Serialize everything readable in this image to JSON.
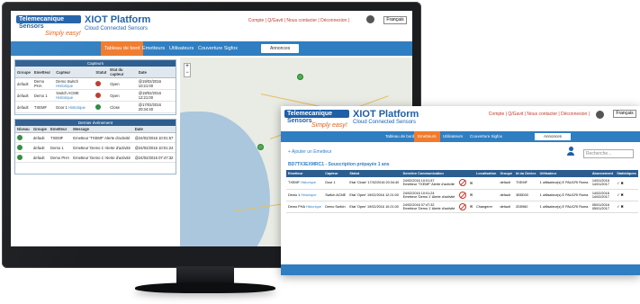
{
  "brand": {
    "logo_top": "Telemecanique",
    "logo_bottom": "Sensors",
    "tagline": "Simply easy!"
  },
  "app": {
    "title": "XIOT Platform",
    "subtitle": "Cloud Connected Sensors"
  },
  "top_links": "Compte | Q/Gavit | Nous contacter | Déconnexion |",
  "language": "Français",
  "nav": {
    "tabs": [
      "Tableau de bord",
      "Emetteurs",
      "Utilisateurs",
      "Couverture Sigfox"
    ],
    "active": 0,
    "button": "Annonces"
  },
  "capteurs_panel": {
    "title": "Capteurs",
    "headers": [
      "Groupe",
      "Emetteur",
      "Capteur",
      "Statut",
      "Etat du capteur",
      "Date"
    ],
    "rows": [
      {
        "groupe": "default",
        "emetteur": "Demo PHA",
        "capteur": "Demo Switch",
        "capteur_link": "Historique",
        "statut_color": "red",
        "etat": "Open",
        "date": "@19/02/2016 10:21:00"
      },
      {
        "groupe": "default",
        "emetteur": "Demo 1",
        "capteur": "Switch ACME",
        "capteur_link": "Historique",
        "statut_color": "red",
        "etat": "Open",
        "date": "@19/02/2016 12:21:00"
      },
      {
        "groupe": "default",
        "emetteur": "TXEMF",
        "capteur": "Door 1",
        "capteur_link": "Historique",
        "statut_color": "green",
        "etat": "Close",
        "date": "@17/02/2016 20:34:40"
      }
    ]
  },
  "events_panel": {
    "title": "Dernier événement",
    "headers": [
      "Niveau",
      "Groupe",
      "Emetteur",
      "Message",
      "Date"
    ],
    "rows": [
      {
        "groupe": "default",
        "emetteur": "TXEMF",
        "message": "Emetteur 'TXEMF' Alerte d'activité",
        "date": "@24/02/2016 10:01:57"
      },
      {
        "groupe": "default",
        "emetteur": "Demo 1",
        "message": "Emetteur 'Demo 1' Alerte d'activité",
        "date": "@24/02/2016 10:01:24"
      },
      {
        "groupe": "default",
        "emetteur": "Demo PHA",
        "message": "Emetteur 'Demo 1' Alerte d'activité",
        "date": "@24/02/2016 07:47:32"
      }
    ]
  },
  "window2": {
    "add_link": "+ Ajouter un Emetteur",
    "section_title": "BD7TX3EXMRC1 - Souscription prépayée 1 ans",
    "search_placeholder": "Recherche...",
    "nav_tabs": [
      "Tableau de bord",
      "Emetteurs",
      "Utilisateurs",
      "Couverture Sigfox"
    ],
    "nav_active": 1,
    "nav_button": "Annonces",
    "headers": [
      "Emetteur",
      "Capteur",
      "Statut",
      "Dernière Communication",
      "",
      "",
      "Localisation",
      "Groupe",
      "Id du Device",
      "",
      "Utilisateur",
      "",
      "Abonnement",
      "Statistiques"
    ],
    "rows": [
      {
        "emetteur": "TXEMF",
        "link": "Historique",
        "capteur": "Door 1",
        "statut": "Etat 'Close' 17/02/2016 20:34:40",
        "comm": "24/02/2016 10:01:57",
        "comm_msg": "Emetteur 'TXEMF' Alerte d'activité",
        "loc": "",
        "groupe": "default",
        "device": "TXEMF",
        "u1": "1 utilisateur(s)",
        "u2": "E PAUCRI",
        "u3": "Roma",
        "abo1": "14/01/2016",
        "abo2": "14/01/2017",
        "stat": "✓ ✖"
      },
      {
        "emetteur": "Demo 1",
        "link": "Historique",
        "capteur": "Switch ACME",
        "statut": "Etat 'Open' 19/02/2016 12:21:00",
        "comm": "24/02/2016 10:01:24",
        "comm_msg": "Emetteur 'Demo 1' Alerte d'activité",
        "loc": "",
        "groupe": "default",
        "device": "3B5D00",
        "u1": "1 utilisateur(s)",
        "u2": "E PAUCRI",
        "u3": "Roma",
        "abo1": "14/02/2016",
        "abo2": "14/02/2017",
        "stat": "✓ ✖"
      },
      {
        "emetteur": "Demo PHA",
        "link": "Historique",
        "capteur": "Demo Switch",
        "statut": "Etat 'Open' 19/02/2016 10:21:00",
        "comm": "24/02/2016 07:47:32",
        "comm_msg": "Emetteur 'Demo 1' Alerte d'activité",
        "loc": "Changerer",
        "groupe": "default",
        "device": "2D5960",
        "u1": "1 utilisateur(s)",
        "u2": "E PAUCRI",
        "u3": "Roma",
        "abo1": "05/01/2016",
        "abo2": "05/01/2017",
        "stat": "✓ ✖"
      }
    ]
  },
  "colors": {
    "primary": "#2f7ec1",
    "accent": "#f07b2d",
    "panel_header": "#2c5d8f",
    "red": "#c0392b",
    "green": "#2e8b3d"
  }
}
